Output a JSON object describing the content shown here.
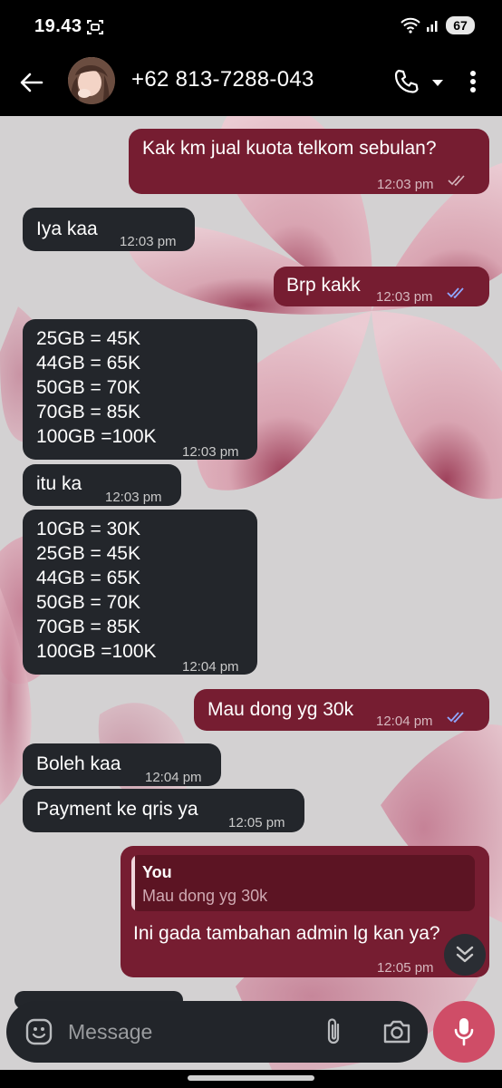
{
  "status_bar": {
    "time": "19.43",
    "battery": "67",
    "icons": [
      "screenshot-icon",
      "wifi-icon",
      "signal-icon",
      "battery-icon"
    ]
  },
  "header": {
    "contact": "+62 813-7288-043",
    "icons": [
      "back-arrow-icon",
      "avatar",
      "phone-icon",
      "chevron-down-icon",
      "more-vert-icon"
    ]
  },
  "colors": {
    "outgoing_bubble": "#761d31",
    "incoming_bubble": "#23262b",
    "read_tick": "#8fa8ff",
    "mic_button": "#cf4d67"
  },
  "messages": [
    {
      "direction": "out",
      "text": "Kak km jual kuota telkom sebulan?",
      "time": "12:03 pm",
      "status": "delivered"
    },
    {
      "direction": "in",
      "text": "Iya kaa",
      "time": "12:03 pm"
    },
    {
      "direction": "out",
      "text": "Brp kakk",
      "time": "12:03 pm",
      "status": "read"
    },
    {
      "direction": "in",
      "lines": [
        "25GB = 45K",
        "44GB = 65K",
        "50GB = 70K",
        "70GB = 85K",
        "100GB =100K"
      ],
      "time": "12:03 pm"
    },
    {
      "direction": "in",
      "text": "itu ka",
      "time": "12:03 pm"
    },
    {
      "direction": "in",
      "lines": [
        "10GB = 30K",
        "25GB = 45K",
        "44GB = 65K",
        "50GB = 70K",
        "70GB = 85K",
        "100GB =100K"
      ],
      "time": "12:04 pm"
    },
    {
      "direction": "out",
      "text": "Mau dong yg 30k",
      "time": "12:04 pm",
      "status": "read"
    },
    {
      "direction": "in",
      "text": "Boleh kaa",
      "time": "12:04 pm"
    },
    {
      "direction": "in",
      "text": "Payment ke qris ya",
      "time": "12:05 pm"
    },
    {
      "direction": "out",
      "quote": {
        "author": "You",
        "text": "Mau dong yg 30k"
      },
      "text": "Ini gada tambahan admin lg kan ya?",
      "time": "12:05 pm"
    }
  ],
  "composer": {
    "placeholder": "Message",
    "icons": [
      "emoji-icon",
      "attach-icon",
      "camera-icon",
      "mic-icon"
    ]
  }
}
